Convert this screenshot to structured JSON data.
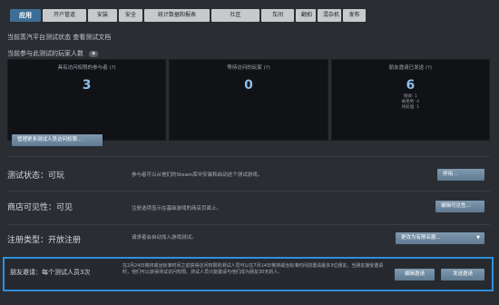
{
  "tabs": [
    {
      "label": "应用"
    },
    {
      "label": "开户管道"
    },
    {
      "label": "安装"
    },
    {
      "label": "安全"
    },
    {
      "label": "统计数据和报表"
    },
    {
      "label": "社区"
    },
    {
      "label": "车间"
    },
    {
      "label": "翻拍"
    },
    {
      "label": "混杂机"
    },
    {
      "label": "发布"
    }
  ],
  "header": {
    "status_link": "当前蒸汽平台测试状态 查看测试文档",
    "players_title": "当前参与此测试的玩家人数"
  },
  "stats": [
    {
      "label": "具有访问权限的参与者 (?)",
      "value": "3",
      "sub": []
    },
    {
      "label": "等待访问的玩家 (?)",
      "value": "0",
      "sub": []
    },
    {
      "label": "朋友邀请已发送 (?)",
      "value": "6",
      "sub": [
        "接收: 1",
        "被拒绝: 4",
        "待处理: 1"
      ]
    }
  ],
  "manage_button": "管理更多测试人员访问权限...",
  "rows": {
    "status": {
      "title": "测试状态：可玩",
      "desc": "参与者可以从他们的Steam库中安装和启动这个测试游戏。",
      "button": "停用..."
    },
    "store": {
      "title": "商店可见性：可见",
      "desc": "注册选项显示在基础游戏的商店页面上。",
      "button": "编辑可见性..."
    },
    "signup": {
      "title": "注册类型：开放注册",
      "desc": "请求者会自动加入游戏测试。",
      "dropdown": "更改为有限名额..."
    },
    "invite": {
      "title": "朋友邀请：每个测试人员3次",
      "desc": "在2月24日格林威治标准时间之前获得访问权限的测试人员可以在7月14日格林威治标准时间前邀请最多3位朋友。当朋友接受邀请时，他们可以获得测试访问权限。测试人员只能邀请与他们成为朋友30天的人。",
      "edit_button": "编辑邀请",
      "send_button": "发送邀请"
    }
  }
}
